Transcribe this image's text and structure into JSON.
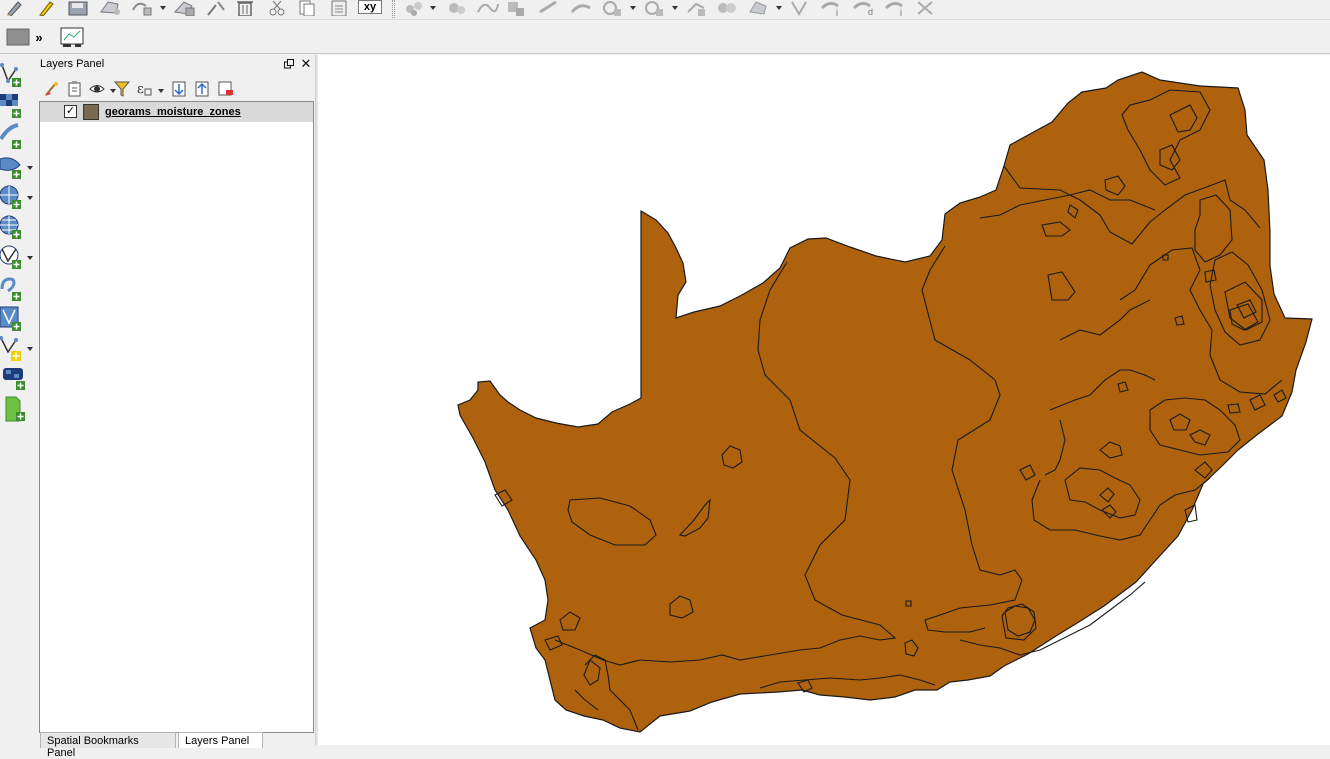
{
  "toolbars": {
    "top_icons": [
      "digitize-icon",
      "pencil-icon",
      "save-edits-icon",
      "add-feature-icon",
      "move-feature-icon",
      "add-ring-icon",
      "node-tool-icon",
      "delete-icon",
      "cut-icon",
      "copy-icon",
      "paste-icon"
    ],
    "xy_label": "xy",
    "expand_label": "»"
  },
  "left_toolbar": {
    "items": [
      "add-vector-layer-icon",
      "add-raster-layer-icon",
      "add-delimited-text-icon",
      "add-spatialite-icon",
      "add-wms-icon",
      "add-wfs-icon",
      "add-wcs-icon",
      "add-virtual-layer-icon",
      "add-spatial-bookmark-icon",
      "new-shapefile-icon",
      "add-mesh-icon",
      "new-geopackage-icon"
    ]
  },
  "layers_panel": {
    "title": "Layers Panel",
    "close_glyph": "✕",
    "layers": [
      {
        "name": "georams_moisture_zones",
        "checked": true,
        "swatch_color": "#7a6a4f"
      }
    ]
  },
  "tabs": {
    "bookmarks": "Spatial Bookmarks Panel",
    "layers": "Layers Panel"
  },
  "map": {
    "fill_color": "#ae620e",
    "stroke_color": "#1a1a1a",
    "background": "#ffffff"
  }
}
